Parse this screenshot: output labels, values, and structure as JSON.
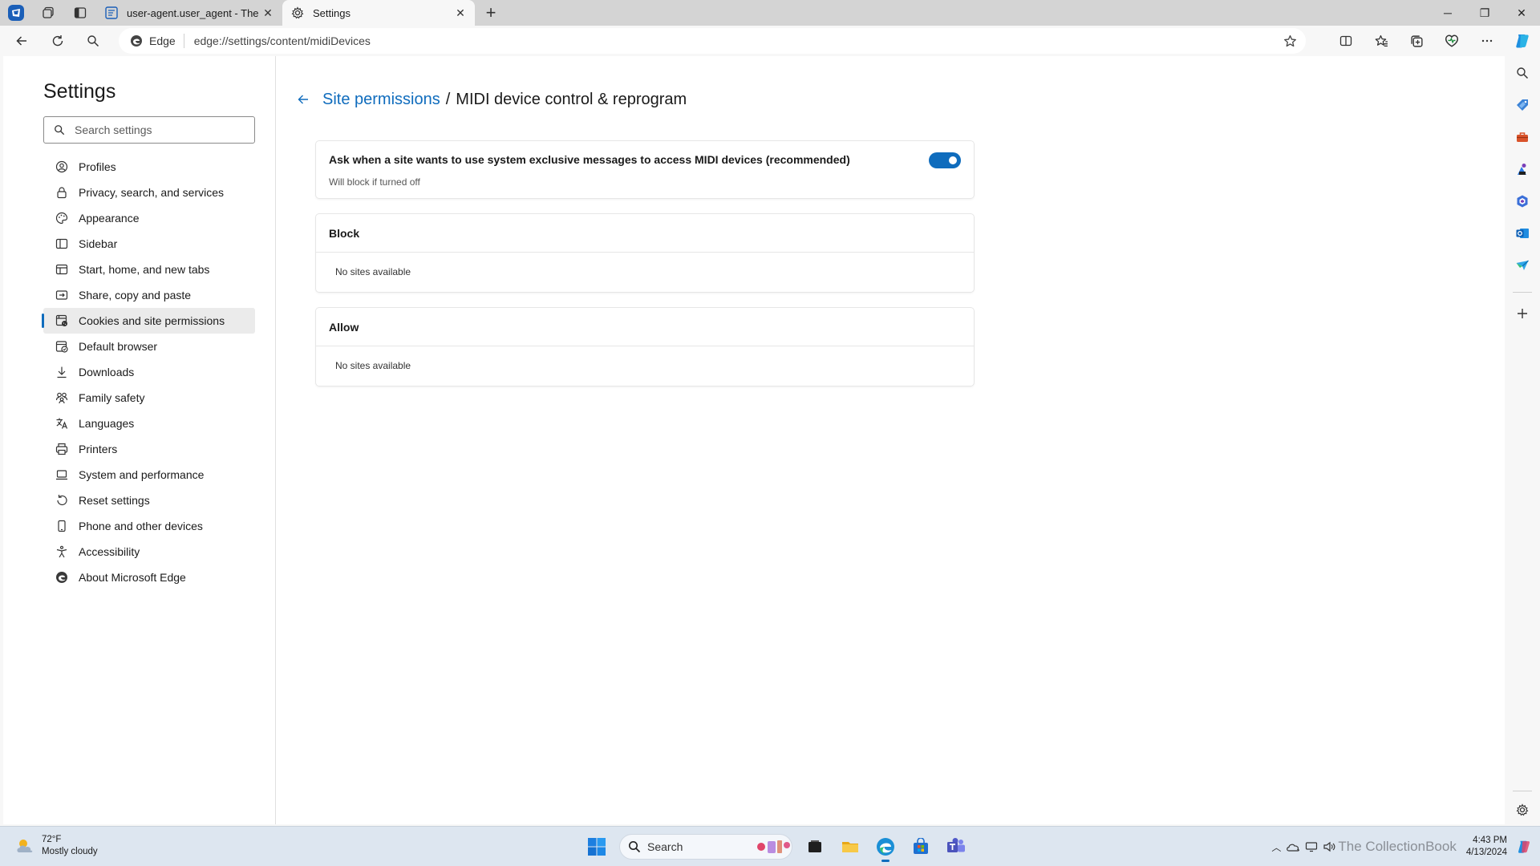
{
  "browser": {
    "tabs": [
      {
        "title": "user-agent.user_agent - The Coll",
        "active": false
      },
      {
        "title": "Settings",
        "active": true
      }
    ],
    "address": {
      "site_label": "Edge",
      "url": "edge://settings/content/midiDevices"
    },
    "icons": {
      "profile": "profile-icon",
      "workspaces": "workspaces-icon",
      "vertical_tabs": "vertical-tabs-icon",
      "back": "back-arrow-icon",
      "refresh": "refresh-icon",
      "search": "search-icon",
      "favorite": "star-icon",
      "split_screen": "split-screen-icon",
      "favorites": "favorites-icon",
      "collections": "collections-icon",
      "browser_essentials": "browser-essentials-icon",
      "more": "more-icon",
      "copilot": "copilot-icon"
    }
  },
  "settings": {
    "title": "Settings",
    "search_placeholder": "Search settings",
    "nav": [
      {
        "label": "Profiles",
        "icon": "profile-icon",
        "active": false
      },
      {
        "label": "Privacy, search, and services",
        "icon": "lock-icon",
        "active": false
      },
      {
        "label": "Appearance",
        "icon": "palette-icon",
        "active": false
      },
      {
        "label": "Sidebar",
        "icon": "sidebar-icon",
        "active": false
      },
      {
        "label": "Start, home, and new tabs",
        "icon": "home-icon",
        "active": false
      },
      {
        "label": "Share, copy and paste",
        "icon": "share-icon",
        "active": false
      },
      {
        "label": "Cookies and site permissions",
        "icon": "cookies-icon",
        "active": true
      },
      {
        "label": "Default browser",
        "icon": "browser-icon",
        "active": false
      },
      {
        "label": "Downloads",
        "icon": "download-icon",
        "active": false
      },
      {
        "label": "Family safety",
        "icon": "family-icon",
        "active": false
      },
      {
        "label": "Languages",
        "icon": "languages-icon",
        "active": false
      },
      {
        "label": "Printers",
        "icon": "printer-icon",
        "active": false
      },
      {
        "label": "System and performance",
        "icon": "laptop-icon",
        "active": false
      },
      {
        "label": "Reset settings",
        "icon": "reset-icon",
        "active": false
      },
      {
        "label": "Phone and other devices",
        "icon": "phone-icon",
        "active": false
      },
      {
        "label": "Accessibility",
        "icon": "accessibility-icon",
        "active": false
      },
      {
        "label": "About Microsoft Edge",
        "icon": "edge-logo-icon",
        "active": false
      }
    ]
  },
  "page": {
    "breadcrumb_link": "Site permissions",
    "breadcrumb_sep": "/",
    "breadcrumb_current": "MIDI device control & reprogram",
    "ask_title": "Ask when a site wants to use system exclusive messages to access MIDI devices (recommended)",
    "ask_subtitle": "Will block if turned off",
    "ask_toggle_on": true,
    "block_title": "Block",
    "block_empty": "No sites available",
    "allow_title": "Allow",
    "allow_empty": "No sites available"
  },
  "sidebar_icons": [
    "search-icon",
    "shopping-icon",
    "tools-icon",
    "games-icon",
    "microsoft365-icon",
    "outlook-icon",
    "drop-icon",
    "add-icon",
    "settings-gear-icon"
  ],
  "taskbar": {
    "weather_temp": "72°F",
    "weather_desc": "Mostly cloudy",
    "search_label": "Search",
    "time": "4:43 PM",
    "date": "4/13/2024",
    "watermark": "The CollectionBook"
  },
  "colors": {
    "accent": "#0f6cbd",
    "tab_strip": "#d4d4d4",
    "taskbar": "#dde6f0"
  }
}
